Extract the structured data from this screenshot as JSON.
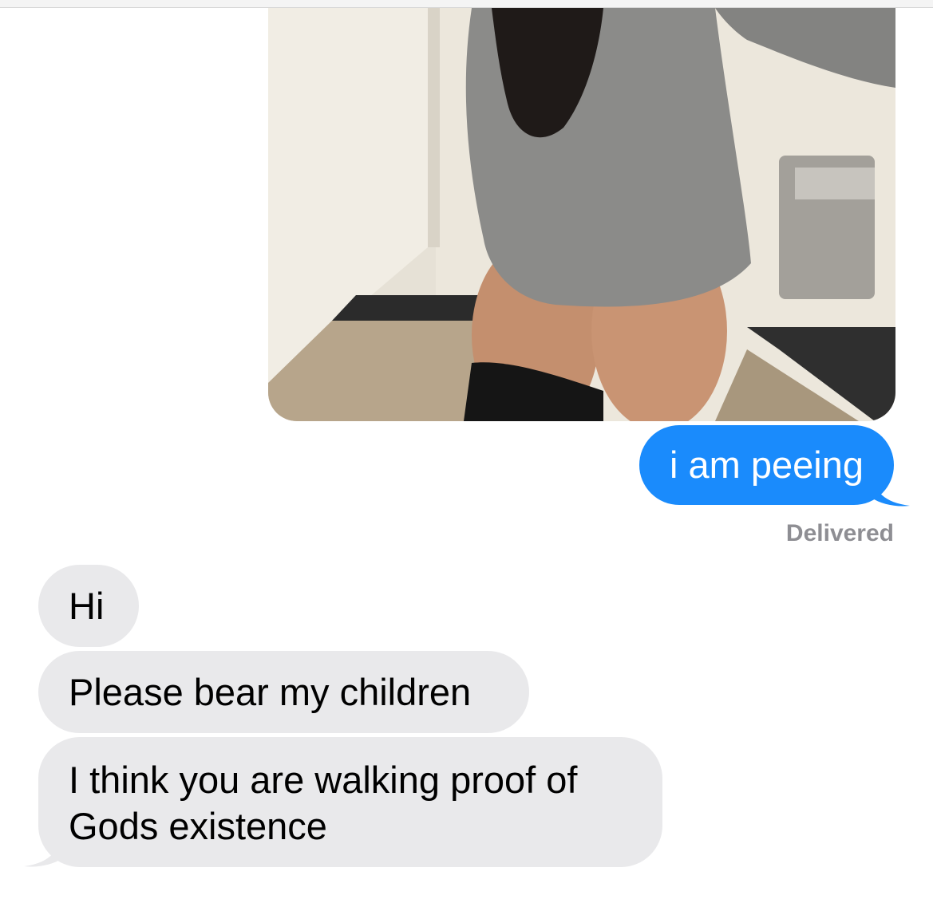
{
  "conversation": {
    "photo": {
      "description_icon": "photo-attachment-icon"
    },
    "outgoing": {
      "text": "i am peeing",
      "status": "Delivered"
    },
    "incoming": [
      {
        "lines": [
          "Hi"
        ]
      },
      {
        "lines": [
          "Please bear my children"
        ]
      },
      {
        "lines": [
          "I think you are walking proof of",
          "Gods existence"
        ]
      }
    ]
  },
  "colors": {
    "outgoing_bubble": "#1a8bfc",
    "incoming_bubble": "#e9e9eb",
    "status_text": "#8e8e93"
  }
}
